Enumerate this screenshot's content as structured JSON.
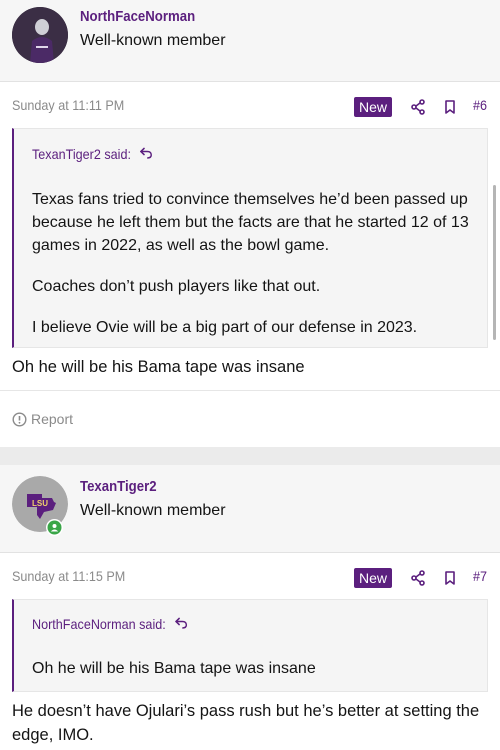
{
  "posts": [
    {
      "username": "NorthFaceNorman",
      "user_title": "Well-known member",
      "date": "Sunday at 11:11 PM",
      "badge": "New",
      "post_number": "#6",
      "quote": {
        "author_line": "TexanTiger2 said:",
        "paragraphs": [
          "Texas fans tried to convince themselves he’d been passed up because he left them but the facts are that he started 12 of 13 games in 2022, as well as the bowl game.",
          "Coaches don’t push players like that out.",
          "I believe Ovie will be a big part of our defense in 2023."
        ]
      },
      "body": "Oh he will be his Bama tape was insane",
      "report_label": "Report"
    },
    {
      "username": "TexanTiger2",
      "user_title": "Well-known member",
      "avatar_text": "LSU",
      "date": "Sunday at 11:15 PM",
      "badge": "New",
      "post_number": "#7",
      "quote": {
        "author_line": "NorthFaceNorman said:",
        "paragraphs": [
          "Oh he will be his Bama tape was insane"
        ]
      },
      "body": "He doesn’t have Ojulari’s pass rush but he’s better at setting the edge, IMO."
    }
  ],
  "colors": {
    "accent": "#5b1f7e",
    "meta_text": "#8a8a8a",
    "online": "#3aa648"
  },
  "icons": [
    "share-icon",
    "bookmark-icon",
    "reply-arrow-icon",
    "report-icon",
    "online-indicator-icon"
  ]
}
